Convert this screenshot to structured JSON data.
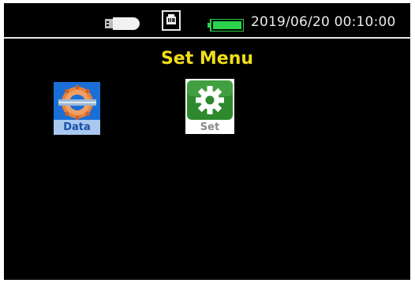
{
  "status_bar": {
    "usb_icon": "usb-icon",
    "lan_icon": "network-port-icon",
    "battery_icon": "battery-icon",
    "battery_level": 1.0,
    "battery_color": "#2bd14a",
    "datetime": "2019/06/20 00:10:00"
  },
  "page": {
    "title": "Set Menu",
    "title_color": "#f2dd1c"
  },
  "apps": [
    {
      "label": "Data",
      "icon": "data-gear-icon",
      "color": "#1a6fd6"
    },
    {
      "label": "Set",
      "icon": "settings-gear-icon",
      "color": "#2f8a2e"
    }
  ]
}
